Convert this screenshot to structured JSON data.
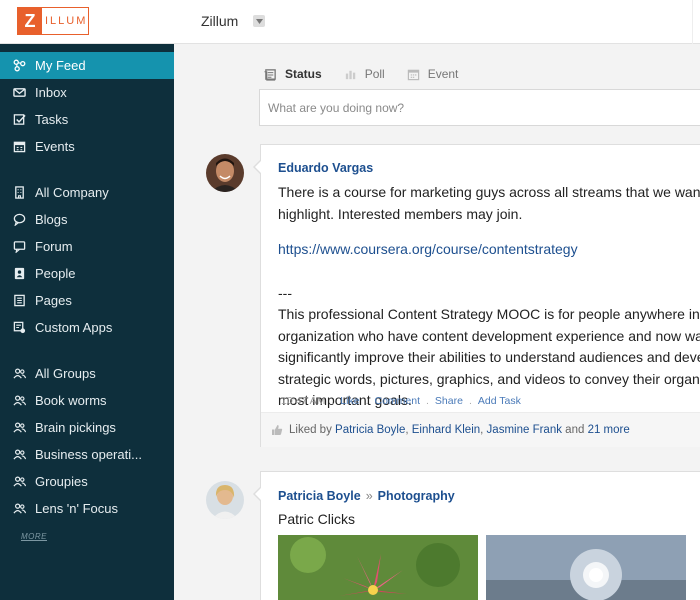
{
  "app": {
    "logo_letter": "Z",
    "logo_rest": "ILLUM",
    "org_name": "Zillum"
  },
  "sidebar": {
    "items": [
      {
        "label": "My Feed",
        "icon": "feed-icon",
        "active": true
      },
      {
        "label": "Inbox",
        "icon": "inbox-icon"
      },
      {
        "label": "Tasks",
        "icon": "tasks-icon"
      },
      {
        "label": "Events",
        "icon": "calendar-icon"
      },
      {
        "label": "All Company",
        "icon": "building-icon"
      },
      {
        "label": "Blogs",
        "icon": "blog-icon"
      },
      {
        "label": "Forum",
        "icon": "forum-icon"
      },
      {
        "label": "People",
        "icon": "people-icon"
      },
      {
        "label": "Pages",
        "icon": "pages-icon"
      },
      {
        "label": "Custom Apps",
        "icon": "apps-icon"
      },
      {
        "label": "All Groups",
        "icon": "group-icon"
      },
      {
        "label": "Book worms",
        "icon": "group-icon"
      },
      {
        "label": "Brain pickings",
        "icon": "group-icon"
      },
      {
        "label": "Business operati...",
        "icon": "group-icon"
      },
      {
        "label": "Groupies",
        "icon": "group-icon"
      },
      {
        "label": "Lens 'n' Focus",
        "icon": "group-icon"
      }
    ],
    "more_label": "MORE"
  },
  "composer": {
    "tabs": [
      {
        "label": "Status",
        "icon": "status-icon",
        "active": true
      },
      {
        "label": "Poll",
        "icon": "poll-icon"
      },
      {
        "label": "Event",
        "icon": "event-icon"
      }
    ],
    "placeholder": "What are you doing now?"
  },
  "posts": [
    {
      "author": "Eduardo Vargas",
      "lines": [
        "There is a course for marketing guys across all streams that we wanted t",
        "highlight. Interested members may join.",
        "",
        "https://www.coursera.org/course/contentstrategy",
        "",
        "---",
        "This professional Content Strategy MOOC is for people anywhere in an",
        "organization who have content development experience and now want",
        "significantly improve their abilities to understand audiences and develo",
        "strategic words, pictures, graphics, and videos to convey their organizat",
        "most important goals."
      ],
      "time": "10:47 AM",
      "actions": [
        "Like",
        "Comment",
        "Share",
        "Add Task"
      ],
      "liked_prefix": "Liked by",
      "likers": [
        "Patricia Boyle",
        "Einhard Klein",
        "Jasmine Frank"
      ],
      "liked_and": "and",
      "liked_more": "21 more"
    },
    {
      "author": "Patricia Boyle",
      "group": "Photography",
      "text": "Patric Clicks"
    }
  ],
  "colors": {
    "sidebar_bg": "#0e2f3c",
    "active_bg": "#1593ae",
    "brand": "#e8602c",
    "link": "#1d4f8f"
  }
}
